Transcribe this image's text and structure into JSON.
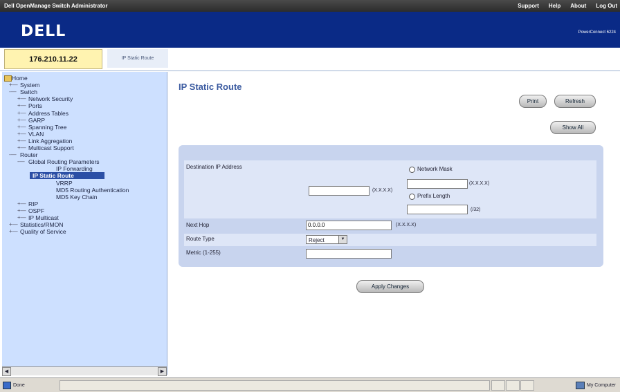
{
  "topbar": {
    "title": "Dell OpenManage Switch Administrator",
    "links": [
      "Support",
      "Help",
      "About",
      "Log Out"
    ]
  },
  "banner": {
    "logo": "DELL",
    "product": "PowerConnect 6224"
  },
  "tabs": {
    "ip": "176.210.11.22",
    "breadcrumb": "IP Static Route"
  },
  "sidebar": {
    "items": [
      {
        "label": "Home",
        "level": 0,
        "glyph": "icon"
      },
      {
        "label": "System",
        "level": 1,
        "glyph": "+"
      },
      {
        "label": "Switch",
        "level": 1,
        "glyph": "-"
      },
      {
        "label": "Network Security",
        "level": 2,
        "glyph": "+"
      },
      {
        "label": "Ports",
        "level": 2,
        "glyph": "+"
      },
      {
        "label": "Address Tables",
        "level": 2,
        "glyph": "+"
      },
      {
        "label": "GARP",
        "level": 2,
        "glyph": "+"
      },
      {
        "label": "Spanning Tree",
        "level": 2,
        "glyph": "+"
      },
      {
        "label": "VLAN",
        "level": 2,
        "glyph": "+"
      },
      {
        "label": "Link Aggregation",
        "level": 2,
        "glyph": "+"
      },
      {
        "label": "Multicast Support",
        "level": 2,
        "glyph": "+"
      },
      {
        "label": "Router",
        "level": 1,
        "glyph": "-"
      },
      {
        "label": "Global Routing Parameters",
        "level": 2,
        "glyph": "-"
      },
      {
        "label": "IP Forwarding",
        "level": 3,
        "glyph": ""
      },
      {
        "label": "IP Static Route",
        "level": 3,
        "glyph": "",
        "selected": true
      },
      {
        "label": "VRRP",
        "level": 3,
        "glyph": ""
      },
      {
        "label": "MD5 Routing Authentication",
        "level": 3,
        "glyph": ""
      },
      {
        "label": "MD5 Key Chain",
        "level": 3,
        "glyph": ""
      },
      {
        "label": "RIP",
        "level": 2,
        "glyph": "+"
      },
      {
        "label": "OSPF",
        "level": 2,
        "glyph": "+"
      },
      {
        "label": "IP Multicast",
        "level": 2,
        "glyph": "+"
      },
      {
        "label": "Statistics/RMON",
        "level": 1,
        "glyph": "+"
      },
      {
        "label": "Quality of Service",
        "level": 1,
        "glyph": "+"
      }
    ]
  },
  "main": {
    "title": "IP Static Route",
    "buttons": {
      "print": "Print",
      "refresh": "Refresh",
      "show_all": "Show All",
      "apply": "Apply Changes"
    },
    "form": {
      "dest_ip_label": "Destination IP Address",
      "dest_ip_value": "",
      "dest_ip_hint": "(X.X.X.X)",
      "network_mask_label": "Network Mask",
      "network_mask_value": "",
      "network_mask_hint": "(X.X.X.X)",
      "prefix_length_label": "Prefix Length",
      "prefix_length_value": "",
      "prefix_length_hint": "(/32)",
      "next_hop_label": "Next Hop",
      "next_hop_value": "0.0.0.0",
      "next_hop_hint": "(X.X.X.X)",
      "route_type_label": "Route Type",
      "route_type_value": "Reject",
      "metric_label": "Metric (1-255)",
      "metric_value": ""
    }
  },
  "statusbar": {
    "left": "Done",
    "right": "My Computer"
  }
}
